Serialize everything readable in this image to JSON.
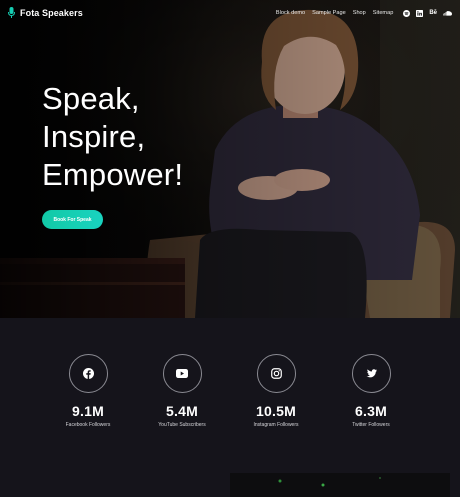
{
  "header": {
    "brand": "Fota Speakers",
    "nav": [
      "Block demo",
      "Sample Page",
      "Shop",
      "Sitemap"
    ],
    "social": [
      {
        "icon": "spotify-icon",
        "glyph": ""
      },
      {
        "icon": "linkedin-icon",
        "glyph": "in"
      },
      {
        "icon": "behance-icon",
        "glyph": "Bē"
      },
      {
        "icon": "soundcloud-icon",
        "glyph": ""
      }
    ]
  },
  "hero": {
    "headline": [
      "Speak,",
      "Inspire,",
      "Empower!"
    ],
    "cta_label": "Book For Speak"
  },
  "stats": [
    {
      "icon": "facebook-icon",
      "value": "9.1M",
      "label": "Facebook Followers"
    },
    {
      "icon": "youtube-icon",
      "value": "5.4M",
      "label": "YouTube Subscribers"
    },
    {
      "icon": "instagram-icon",
      "value": "10.5M",
      "label": "Instagram Followers"
    },
    {
      "icon": "twitter-icon",
      "value": "6.3M",
      "label": "Twitter Followers"
    }
  ],
  "colors": {
    "accent": "#16cdb2",
    "background": "#15141b"
  }
}
